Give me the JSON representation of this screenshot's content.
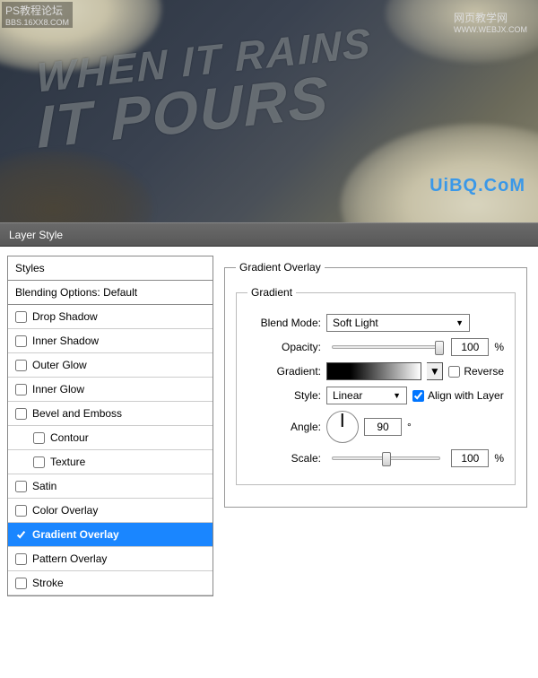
{
  "preview": {
    "line1": "WHEN IT RAINS",
    "line2": "IT POURS",
    "badge_left": "PS教程论坛",
    "badge_left_sub": "BBS.16XX8.COM",
    "badge_right": "网页教学网",
    "badge_right_sub": "WWW.WEBJX.COM",
    "watermark": "UiBQ.CoM"
  },
  "dialog": {
    "title": "Layer Style"
  },
  "styles_panel": {
    "header": "Styles",
    "blending": "Blending Options: Default",
    "items": [
      {
        "label": "Drop Shadow",
        "checked": false,
        "indent": false
      },
      {
        "label": "Inner Shadow",
        "checked": false,
        "indent": false
      },
      {
        "label": "Outer Glow",
        "checked": false,
        "indent": false
      },
      {
        "label": "Inner Glow",
        "checked": false,
        "indent": false
      },
      {
        "label": "Bevel and Emboss",
        "checked": false,
        "indent": false
      },
      {
        "label": "Contour",
        "checked": false,
        "indent": true
      },
      {
        "label": "Texture",
        "checked": false,
        "indent": true
      },
      {
        "label": "Satin",
        "checked": false,
        "indent": false
      },
      {
        "label": "Color Overlay",
        "checked": false,
        "indent": false
      },
      {
        "label": "Gradient Overlay",
        "checked": true,
        "indent": false,
        "selected": true
      },
      {
        "label": "Pattern Overlay",
        "checked": false,
        "indent": false
      },
      {
        "label": "Stroke",
        "checked": false,
        "indent": false
      }
    ]
  },
  "gradient_overlay": {
    "section_title": "Gradient Overlay",
    "subsection_title": "Gradient",
    "blend_mode_label": "Blend Mode:",
    "blend_mode_value": "Soft Light",
    "opacity_label": "Opacity:",
    "opacity_value": "100",
    "opacity_unit": "%",
    "gradient_label": "Gradient:",
    "reverse_label": "Reverse",
    "reverse_checked": false,
    "style_label": "Style:",
    "style_value": "Linear",
    "align_label": "Align with Layer",
    "align_checked": true,
    "angle_label": "Angle:",
    "angle_value": "90",
    "angle_unit": "°",
    "scale_label": "Scale:",
    "scale_value": "100",
    "scale_unit": "%"
  }
}
